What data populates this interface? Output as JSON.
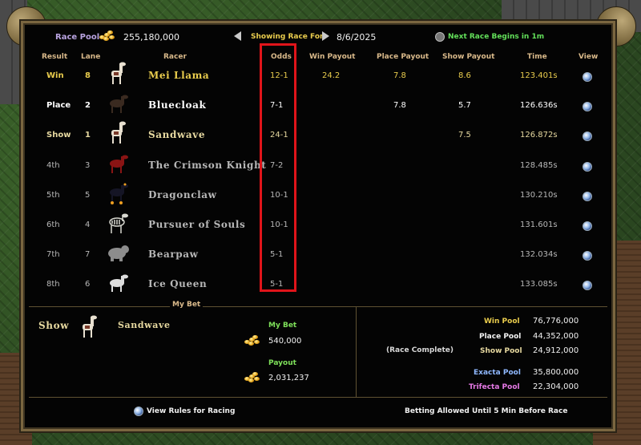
{
  "header": {
    "race_pool_label": "Race Pool",
    "race_pool_value": "255,180,000",
    "showing_label": "Showing Race For",
    "date": "8/6/2025",
    "next_race_label": "Next Race Begins in 1m"
  },
  "columns": {
    "result": "Result",
    "lane": "Lane",
    "racer": "Racer",
    "odds": "Odds",
    "win_payout": "Win Payout",
    "place_payout": "Place Payout",
    "show_payout": "Show Payout",
    "time": "Time",
    "view": "View"
  },
  "rows": [
    {
      "result": "Win",
      "lane": "8",
      "racer": "Mei Llama",
      "odds": "12-1",
      "win": "24.2",
      "place": "7.8",
      "show": "8.6",
      "time": "123.401s",
      "animal": "llama-icon"
    },
    {
      "result": "Place",
      "lane": "2",
      "racer": "Bluecloak",
      "odds": "7-1",
      "win": "",
      "place": "7.8",
      "show": "5.7",
      "time": "126.636s",
      "animal": "dark-horse-icon"
    },
    {
      "result": "Show",
      "lane": "1",
      "racer": "Sandwave",
      "odds": "24-1",
      "win": "",
      "place": "",
      "show": "7.5",
      "time": "126.872s",
      "animal": "llama-icon"
    },
    {
      "result": "4th",
      "lane": "3",
      "racer": "The Crimson Knight",
      "odds": "7-2",
      "win": "",
      "place": "",
      "show": "",
      "time": "128.485s",
      "animal": "red-horse-icon"
    },
    {
      "result": "5th",
      "lane": "5",
      "racer": "Dragonclaw",
      "odds": "10-1",
      "win": "",
      "place": "",
      "show": "",
      "time": "130.210s",
      "animal": "nightmare-icon"
    },
    {
      "result": "6th",
      "lane": "4",
      "racer": "Pursuer of Souls",
      "odds": "10-1",
      "win": "",
      "place": "",
      "show": "",
      "time": "131.601s",
      "animal": "skeletal-horse-icon"
    },
    {
      "result": "7th",
      "lane": "7",
      "racer": "Bearpaw",
      "odds": "5-1",
      "win": "",
      "place": "",
      "show": "",
      "time": "132.034s",
      "animal": "bear-icon"
    },
    {
      "result": "8th",
      "lane": "6",
      "racer": "Ice Queen",
      "odds": "5-1",
      "win": "",
      "place": "",
      "show": "",
      "time": "133.085s",
      "animal": "white-horse-icon"
    }
  ],
  "my_bet": {
    "section_label": "My Bet",
    "type": "Show",
    "racer": "Sandwave",
    "bet_label": "My Bet",
    "bet_value": "540,000",
    "payout_label": "Payout",
    "payout_value": "2,031,237"
  },
  "pools": {
    "status": "(Race Complete)",
    "win_label": "Win Pool",
    "win_value": "76,776,000",
    "place_label": "Place Pool",
    "place_value": "44,352,000",
    "show_label": "Show Pool",
    "show_value": "24,912,000",
    "exacta_label": "Exacta Pool",
    "exacta_value": "35,800,000",
    "trifecta_label": "Trifecta Pool",
    "trifecta_value": "22,304,000"
  },
  "footer": {
    "rules_link": "View Rules for Racing",
    "betting_note": "Betting Allowed Until 5 Min Before Race"
  },
  "colors": {
    "gold_header": "#d9b98a",
    "win_row": "#e9cc4d",
    "place_row": "#ffffff",
    "show_row": "#e7d9a0",
    "lower_rows": "#b7b7b7",
    "highlight_box": "#e0141a"
  }
}
